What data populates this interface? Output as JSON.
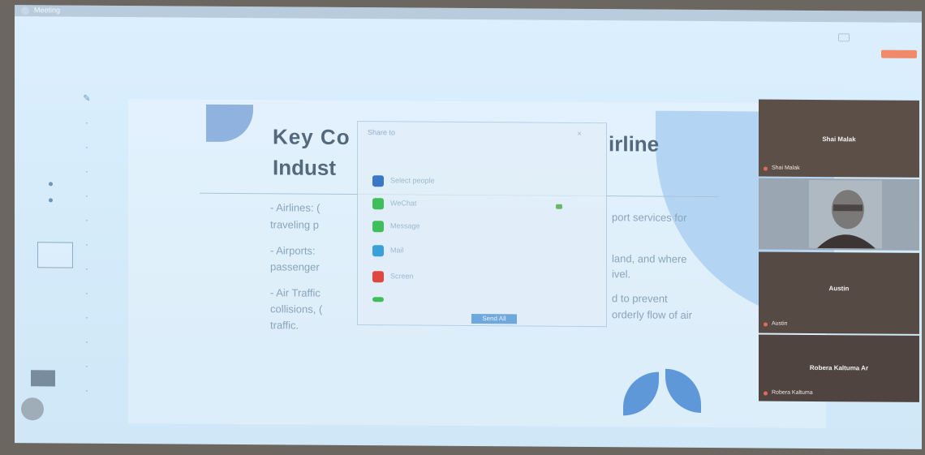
{
  "app": {
    "title": "Meeting"
  },
  "slide": {
    "title_part1": "Key Co",
    "title_part2": "irline",
    "title_line2": "Indust",
    "bullets": [
      {
        "left": "- Airlines: (",
        "left2": "traveling p",
        "right": "port services for"
      },
      {
        "left": "- Airports:",
        "left2": "passenger",
        "right": "land, and where",
        "right2": "ivel."
      },
      {
        "left": "- Air Traffic",
        "left2": "collisions, (",
        "left3": "traffic.",
        "right": "d to prevent",
        "right2": "orderly flow of air"
      }
    ]
  },
  "chat": {
    "header": "Share to",
    "close": "×",
    "items": [
      {
        "label": "Select people",
        "color": "#3a78c6"
      },
      {
        "label": "WeChat",
        "color": "#3fbf5a"
      },
      {
        "label": "Message",
        "color": "#3fbf5a"
      },
      {
        "label": "Mail",
        "color": "#3aa0d8"
      },
      {
        "label": "Screen",
        "color": "#e0473e"
      },
      {
        "label": "",
        "color": "#3fbf5a"
      }
    ],
    "send_label": "Send All"
  },
  "participants": [
    {
      "name": "Shai Malak",
      "sub": "Shai Malak",
      "video": false
    },
    {
      "name": "",
      "sub": "",
      "video": true
    },
    {
      "name": "Austin",
      "sub": "Austin",
      "video": false
    },
    {
      "name": "Robera Kaltuma Ar",
      "sub": "Robera Kaltuma",
      "video": false
    }
  ]
}
